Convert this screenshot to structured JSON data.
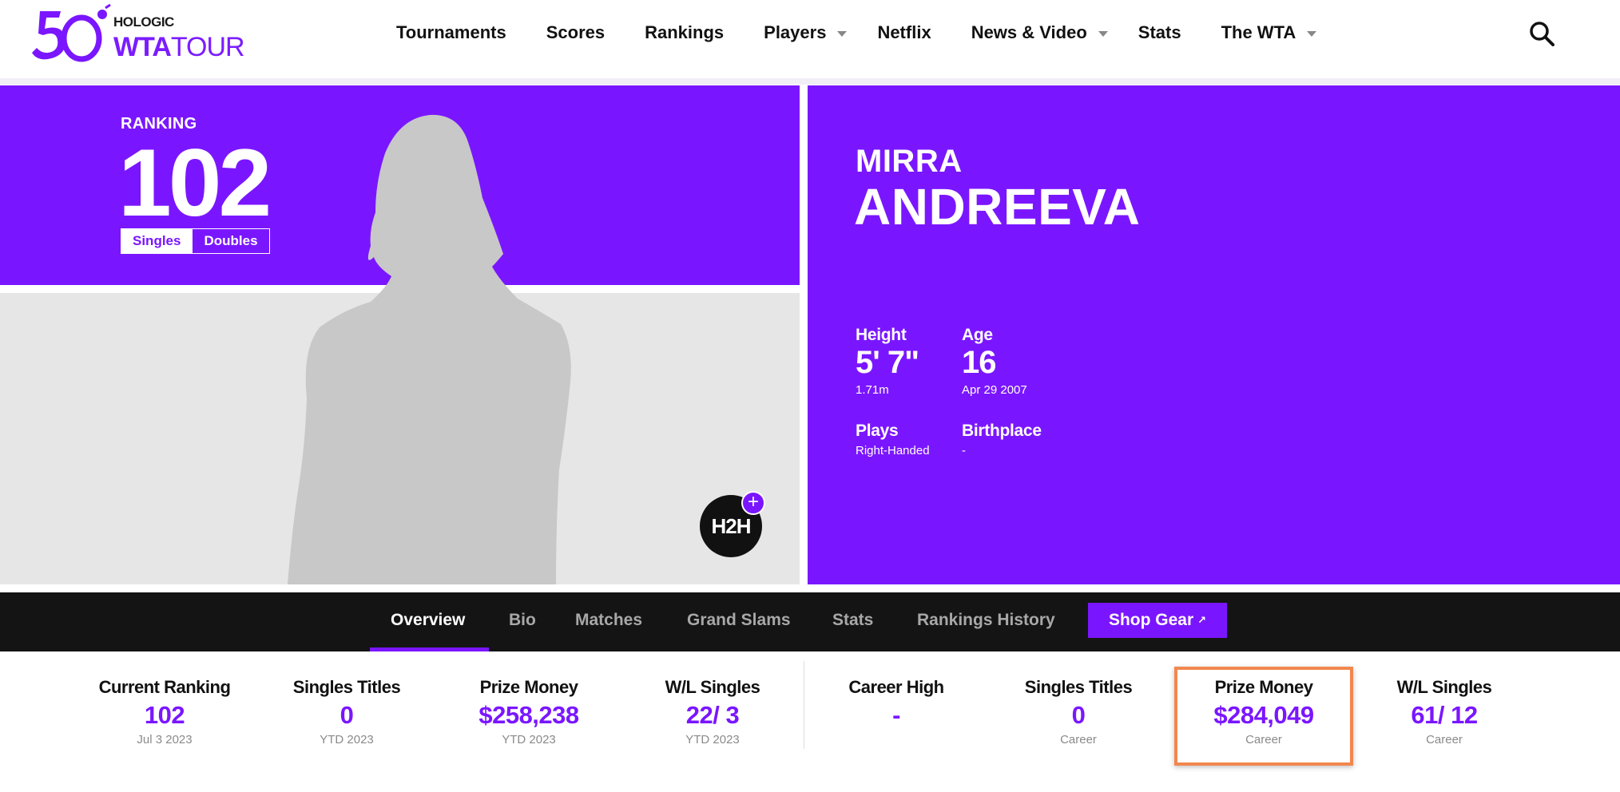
{
  "header": {
    "logo": {
      "brand": "HOLOGIC",
      "wta": "WTA",
      "tour": "TOUR"
    },
    "nav": [
      {
        "label": "Tournaments",
        "caret": false
      },
      {
        "label": "Scores",
        "caret": false
      },
      {
        "label": "Rankings",
        "caret": false
      },
      {
        "label": "Players",
        "caret": true
      },
      {
        "label": "Netflix",
        "caret": false
      },
      {
        "label": "News & Video",
        "caret": true
      },
      {
        "label": "Stats",
        "caret": false
      },
      {
        "label": "The WTA",
        "caret": true
      }
    ]
  },
  "hero": {
    "ranking_label": "RANKING",
    "ranking_value": "102",
    "toggle": {
      "singles": "Singles",
      "doubles": "Doubles",
      "selected": "Singles"
    },
    "h2h": "H2H",
    "h2h_plus": "+"
  },
  "player": {
    "first_name": "MIRRA",
    "last_name": "ANDREEVA",
    "height": {
      "label": "Height",
      "value": "5' 7\"",
      "metric": "1.71m"
    },
    "age": {
      "label": "Age",
      "value": "16",
      "dob": "Apr 29 2007"
    },
    "plays": {
      "label": "Plays",
      "value": "Right-Handed"
    },
    "birthplace": {
      "label": "Birthplace",
      "value": "-"
    }
  },
  "tabs": {
    "items": [
      "Overview",
      "Bio",
      "Matches",
      "Grand Slams",
      "Stats",
      "Rankings History"
    ],
    "active": "Overview",
    "shop": "Shop Gear",
    "shop_icon": "external-link-icon"
  },
  "stats": {
    "ytd": [
      {
        "label": "Current Ranking",
        "value": "102",
        "sub": "Jul 3 2023"
      },
      {
        "label": "Singles Titles",
        "value": "0",
        "sub": "YTD 2023"
      },
      {
        "label": "Prize Money",
        "value": "$258,238",
        "sub": "YTD 2023"
      },
      {
        "label": "W/L Singles",
        "value": "22/ 3",
        "sub": "YTD 2023"
      }
    ],
    "career": [
      {
        "label": "Career High",
        "value": "-",
        "sub": ""
      },
      {
        "label": "Singles Titles",
        "value": "0",
        "sub": "Career"
      },
      {
        "label": "Prize Money",
        "value": "$284,049",
        "sub": "Career"
      },
      {
        "label": "W/L Singles",
        "value": "61/ 12",
        "sub": "Career"
      }
    ]
  },
  "colors": {
    "accent": "#7a16ff",
    "highlight": "#f2874e",
    "tab_bar": "#141414"
  }
}
